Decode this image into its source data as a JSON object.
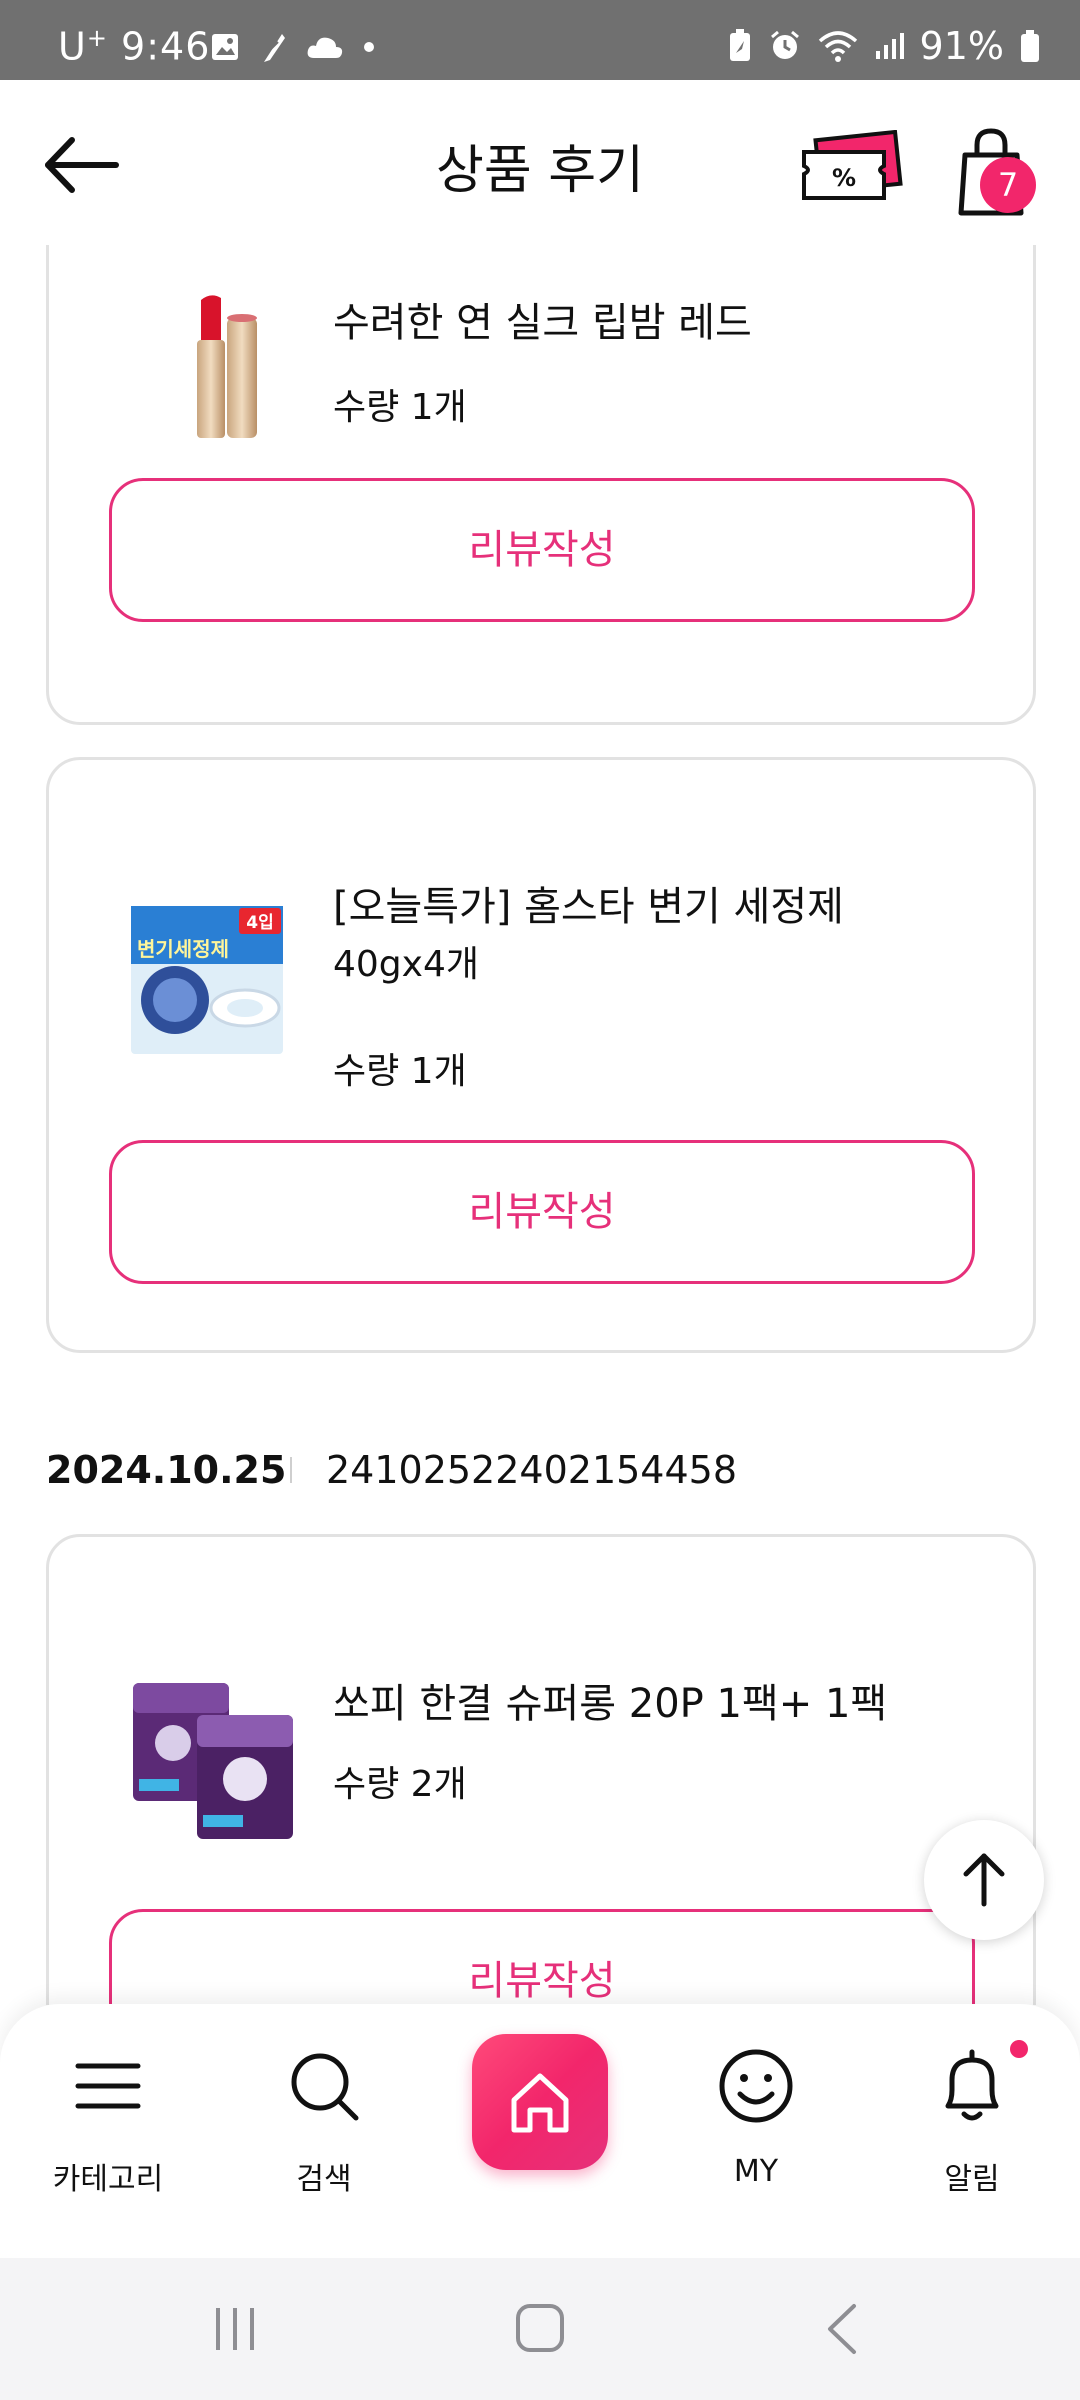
{
  "status_bar": {
    "carrier": "U",
    "carrier_sup": "+",
    "time": "9:46",
    "battery": "91%"
  },
  "header": {
    "title": "상품 후기",
    "cart_count": "7"
  },
  "cards": [
    {
      "name": "수려한 연 실크 립밤 레드",
      "qty": "수량 1개",
      "button": "리뷰작성"
    },
    {
      "name_line1": "[오늘특가] 홈스타 변기 세정제",
      "name_line2": "40gx4개",
      "qty": "수량 1개",
      "button": "리뷰작성",
      "thumb_badge": "4입",
      "thumb_text": "변기세정제"
    },
    {
      "name": "쏘피 한결 슈퍼롱 20P 1팩+ 1팩",
      "qty": "수량 2개",
      "button": "리뷰작성"
    }
  ],
  "order": {
    "date": "2024.10.25",
    "number": "24102522402154458"
  },
  "bottom_nav": {
    "category": "카테고리",
    "search": "검색",
    "my": "MY",
    "alarm": "알림"
  },
  "colors": {
    "accent": "#e6307a",
    "badge": "#f2266b",
    "status_bar": "#707070"
  }
}
